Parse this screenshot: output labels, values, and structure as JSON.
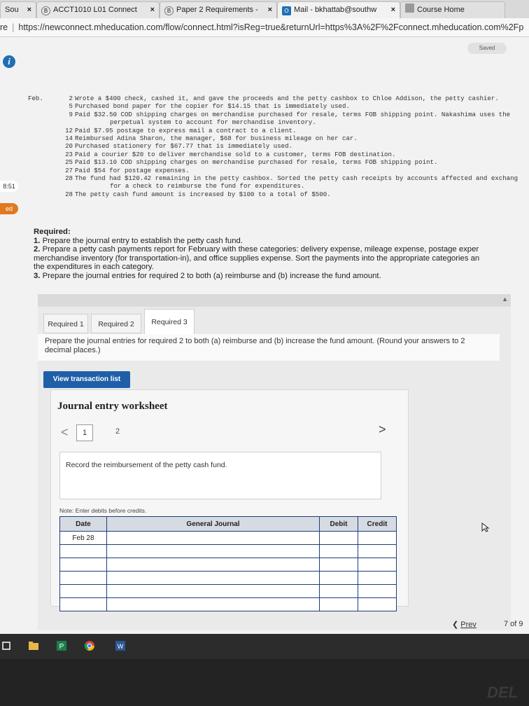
{
  "tabs": [
    {
      "label": "Sou",
      "close": "×"
    },
    {
      "label": "ACCT1010 L01 Connect",
      "close": "×",
      "icon": "B"
    },
    {
      "label": "Paper 2 Requirements -",
      "close": "×",
      "icon": "B"
    },
    {
      "label": "Mail - bkhattab@southw",
      "close": "×",
      "icon": "O"
    },
    {
      "label": "Course Home"
    }
  ],
  "address_prefix": "re",
  "url": "https://newconnect.mheducation.com/flow/connect.html?isReg=true&returnUrl=https%3A%2F%2Fconnect.mheducation.com%2Fp",
  "status": {
    "saved": "Saved"
  },
  "side_badges": {
    "timer": "8:51",
    "label": "ed"
  },
  "problem": {
    "month": "Feb.",
    "lines": [
      {
        "day": "2",
        "text": "Wrote a $400 check, cashed it, and gave the proceeds and the petty cashbox to Chloe Addison, the petty cashier."
      },
      {
        "day": "5",
        "text": "Purchased bond paper for the copier for $14.15 that is immediately used."
      },
      {
        "day": "9",
        "text": "Paid $32.50 COD shipping charges on merchandise purchased for resale, terms FOB shipping point. Nakashima uses the",
        "cont": "perpetual system to account for merchandise inventory."
      },
      {
        "day": "12",
        "text": "Paid $7.95 postage to express mail a contract to a client."
      },
      {
        "day": "14",
        "text": "Reimbursed Adina Sharon, the manager, $68 for business mileage on her car."
      },
      {
        "day": "20",
        "text": "Purchased stationery for $67.77 that is immediately used."
      },
      {
        "day": "23",
        "text": "Paid a courier $20 to deliver merchandise sold to a customer, terms FOB destination."
      },
      {
        "day": "25",
        "text": "Paid $13.10 COD shipping charges on merchandise purchased for resale, terms FOB shipping point."
      },
      {
        "day": "27",
        "text": "Paid $54 for postage expenses."
      },
      {
        "day": "28",
        "text": "The fund had $120.42 remaining in the petty cashbox. Sorted the petty cash receipts by accounts affected and exchang",
        "cont": "for a check to reimburse the fund for expenditures."
      },
      {
        "day": "28",
        "text": "The petty cash fund amount is increased by $100 to a total of $500."
      }
    ]
  },
  "required": {
    "heading": "Required:",
    "items": [
      {
        "num": "1.",
        "text": "Prepare the journal entry to establish the petty cash fund."
      },
      {
        "num": "2.",
        "text": "Prepare a petty cash payments report for February with these categories: delivery expense, mileage expense, postage exper",
        "cont": [
          "merchandise inventory (for transportation-in), and office supplies expense. Sort the payments into the appropriate categories an",
          "the expenditures in each category."
        ]
      },
      {
        "num": "3.",
        "text": "Prepare the journal entries for required 2 to both (a) reimburse and (b) increase the fund amount."
      }
    ]
  },
  "req_tabs": [
    "Required 1",
    "Required 2",
    "Required 3"
  ],
  "instruction": "Prepare the journal entries for required 2 to both (a) reimburse and (b) increase the fund amount. (Round your answers to 2 decimal places.)",
  "view_button": "View transaction list",
  "worksheet": {
    "title": "Journal entry worksheet",
    "prev": "<",
    "next": ">",
    "pages": [
      "1",
      "2"
    ],
    "record_text": "Record the reimbursement of the petty cash fund.",
    "note": "Note: Enter debits before credits.",
    "columns": [
      "Date",
      "General Journal",
      "Debit",
      "Credit"
    ],
    "rows": [
      {
        "date": "Feb 28",
        "account": "",
        "debit": "",
        "credit": ""
      },
      {
        "date": "",
        "account": "",
        "debit": "",
        "credit": ""
      },
      {
        "date": "",
        "account": "",
        "debit": "",
        "credit": ""
      },
      {
        "date": "",
        "account": "",
        "debit": "",
        "credit": ""
      },
      {
        "date": "",
        "account": "",
        "debit": "",
        "credit": ""
      },
      {
        "date": "",
        "account": "",
        "debit": "",
        "credit": ""
      }
    ]
  },
  "footer_nav": {
    "prev_label": "Prev",
    "page": "7 of 9"
  },
  "brand": "DEL",
  "colors": {
    "accent": "#1f5fa8",
    "table_border": "#1d3e77",
    "timer_badge": "#ffffff",
    "label_badge": "#e07a1f"
  }
}
